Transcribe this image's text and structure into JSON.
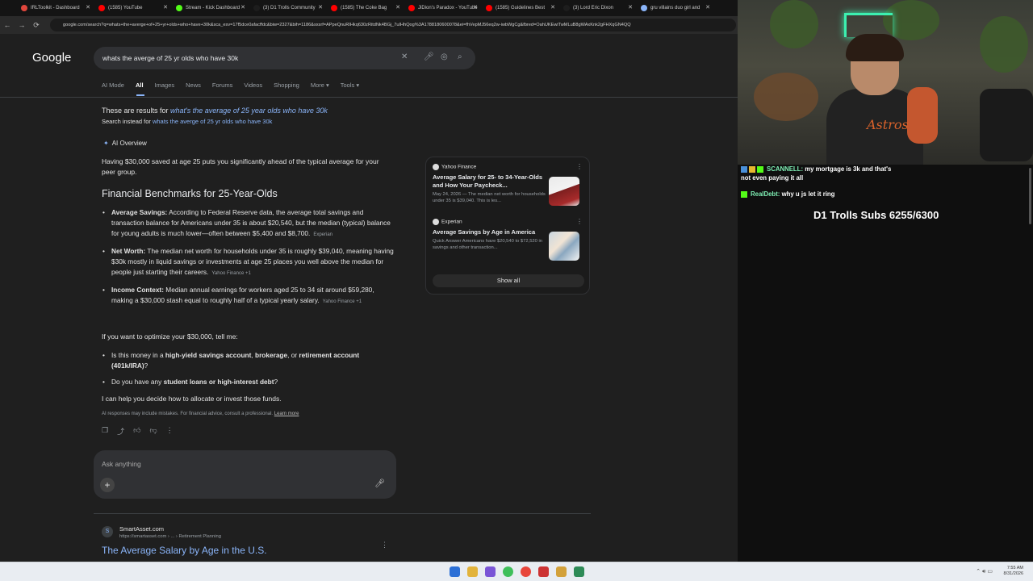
{
  "tabs": [
    {
      "label": "IRLToolkit - Dashboard",
      "color": "#e0463c"
    },
    {
      "label": "(1585) YouTube",
      "color": "#ff0000"
    },
    {
      "label": "Stream - Kick Dashboard",
      "color": "#53fc18"
    },
    {
      "label": "(3) D1 Trolls Community",
      "color": "#1d1d1d"
    },
    {
      "label": "(1585) The Coke Bag",
      "color": "#ff0000"
    },
    {
      "label": "JiDion's Paradox - YouTube",
      "color": "#ff0000"
    },
    {
      "label": "(1585) Guidelines Best",
      "color": "#ff0000"
    },
    {
      "label": "(3) Lord Eric Dixon",
      "color": "#1d1d1d"
    },
    {
      "label": "gru villains duo girl and",
      "color": "#8ab4f8"
    }
  ],
  "url": "google.com/search?q=whats+the+averge+of+25+yr+olds+who+have+30k&sca_esv=17f5dce0afacffdc&biw=2327&bih=1186&sxsrf=APpeQnuRIHkq630zRitdNk4BGj_7uIHhQog%3A1788180600078&ei=fhVepMJ56eq2w-iwbWgCg&fbred=OahUKEwiTwMLuB8gWAxKnk2gFHXqGN4QQ",
  "google": {
    "logo": "Google",
    "query": "whats the averge of 25 yr olds who have 30k",
    "tabs": [
      "AI Mode",
      "All",
      "Images",
      "News",
      "Forums",
      "Videos",
      "Shopping",
      "More ▾",
      "Tools ▾"
    ],
    "active_tab": "All",
    "corrected_prefix": "These are results for ",
    "corrected_query": "what's the average of 25 year olds who have 30k",
    "instead_prefix": "Search instead for ",
    "instead_query": "whats the averge of 25 yr olds who have 30k"
  },
  "ai_overview": {
    "label": "AI Overview",
    "intro": "Having $30,000 saved at age 25 puts you significantly ahead of the typical average for your peer group.",
    "heading": "Financial Benchmarks for 25-Year-Olds",
    "bullets": [
      {
        "lead": "Average Savings:",
        "text": " According to Federal Reserve data, the average total savings and transaction balance for Americans under 35 is about $20,540, but the median (typical) balance for young adults is much lower—often between $5,400 and $8,700.",
        "source": "Experian"
      },
      {
        "lead": "Net Worth:",
        "text": " The median net worth for households under 35 is roughly $39,040, meaning having $30k mostly in liquid savings or investments at age 25 places you well above the median for people just starting their careers.",
        "source": "Yahoo Finance +1"
      },
      {
        "lead": "Income Context:",
        "text": " Median annual earnings for workers aged 25 to 34 sit around $59,280, making a $30,000 stash equal to roughly half of a typical yearly salary.",
        "source": "Yahoo Finance +1"
      }
    ],
    "optimize": "If you want to optimize your $30,000, tell me:",
    "questions": [
      {
        "prefix": "Is this money in a ",
        "b1": "high-yield savings account",
        "mid": ", ",
        "b2": "brokerage",
        "mid2": ", or ",
        "b3": "retirement account (401k/IRA)",
        "suffix": "?"
      },
      {
        "prefix": "Do you have any ",
        "b1": "student loans or high-interest debt",
        "mid": "",
        "b2": "",
        "mid2": "",
        "b3": "",
        "suffix": "?"
      }
    ],
    "decide": "I can help you decide how to allocate or invest those funds.",
    "disclaimer": "AI responses may include mistakes. For financial advice, consult a professional. ",
    "learn_more": "Learn more",
    "ask_placeholder": "Ask anything"
  },
  "sources": [
    {
      "publisher": "Yahoo Finance",
      "title": "Average Salary for 25- to 34-Year-Olds and How Your Paycheck...",
      "snippet": "May 24, 2026 — The median net worth for households under 35 is $39,040. This is les..."
    },
    {
      "publisher": "Experian",
      "title": "Average Savings by Age in America",
      "snippet": "Quick Answer Americans have $20,540 to $72,520 in savings and other transaction..."
    }
  ],
  "show_all": "Show all",
  "result": {
    "site": "SmartAsset.com",
    "url": "https://smartasset.com › ... › Retirement Planning",
    "title": "The Average Salary by Age in the U.S."
  },
  "stream": {
    "chat": [
      {
        "user": "SCANNELL:",
        "text": " my mortgage is 3k and that's not even paying it all"
      },
      {
        "user": "RealDebt:",
        "text": " why u js let it ring"
      }
    ],
    "subs": "D1 Trolls Subs 6255/6300"
  },
  "taskbar": {
    "time": "7:55 AM",
    "date": "8/31/2026"
  }
}
